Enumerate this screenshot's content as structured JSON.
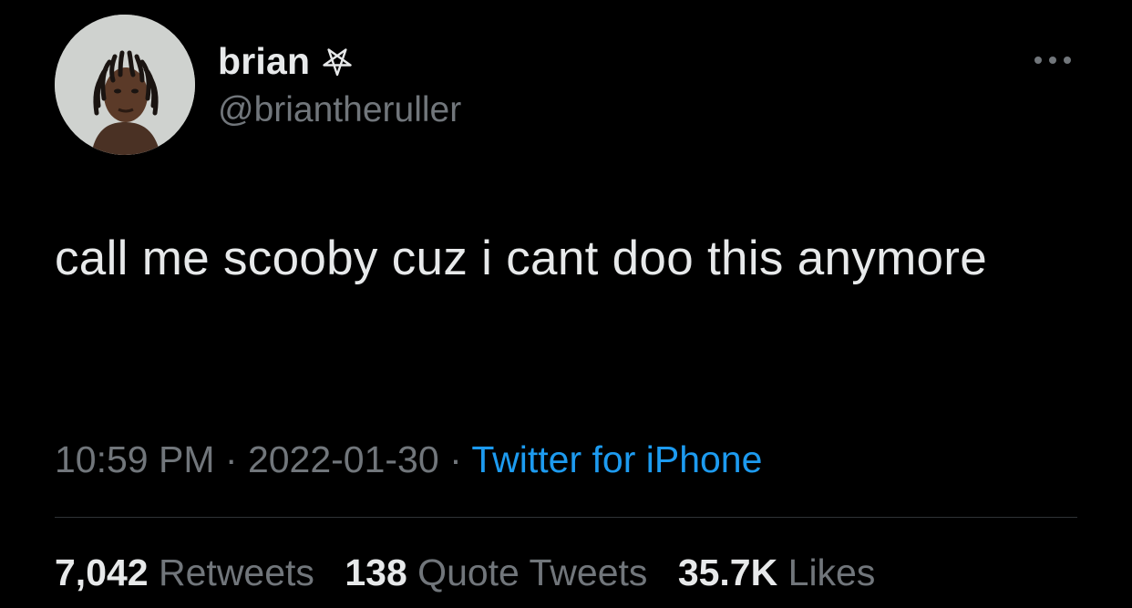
{
  "author": {
    "display_name": "brian",
    "handle": "@briantheruller",
    "badge_icon": "pentagram-icon",
    "avatar_icon": "avatar-photo"
  },
  "menu": {
    "more_icon": "more-horizontal-icon"
  },
  "tweet": {
    "text": "call me scooby cuz i cant doo this anymore"
  },
  "meta": {
    "time": "10:59 PM",
    "separator_1": " · ",
    "date": "2022-01-30",
    "separator_2": " · ",
    "source": "Twitter for iPhone"
  },
  "stats": {
    "retweets_count": "7,042",
    "retweets_label": "Retweets",
    "quotes_count": "138",
    "quotes_label": "Quote Tweets",
    "likes_count": "35.7K",
    "likes_label": "Likes"
  },
  "colors": {
    "background": "#000000",
    "text_primary": "#e7e9ea",
    "text_secondary": "#71767b",
    "link": "#1d9bf0",
    "divider": "#2f3336"
  }
}
